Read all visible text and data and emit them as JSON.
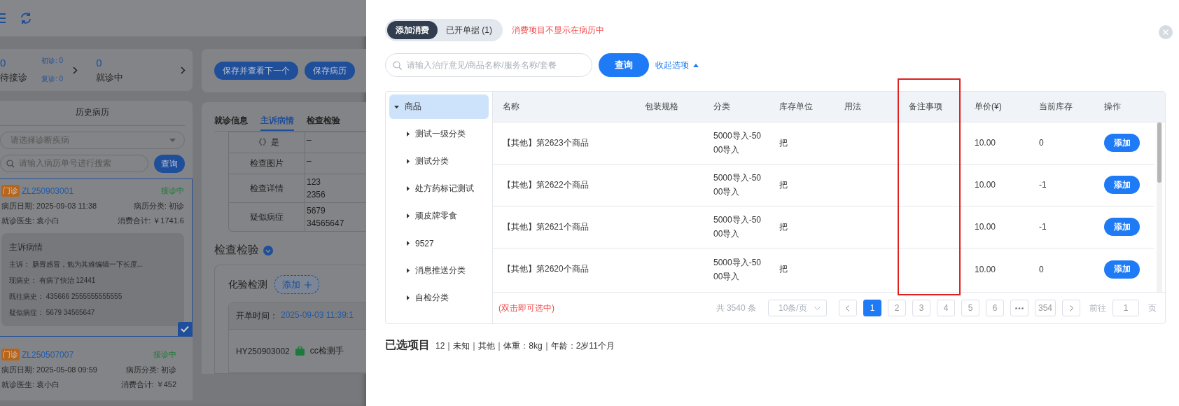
{
  "background_page": {
    "stats": {
      "waiting": {
        "count": "0",
        "label": "待接诊"
      },
      "first_visit": "初诊: 0",
      "revisit": "复诊: 0",
      "in_progress": {
        "count": "0",
        "label": "就诊中"
      }
    },
    "history": {
      "title": "历史病历",
      "diagnosis_select": {
        "placeholder": "请选择诊断疾病"
      },
      "search": {
        "placeholder": "请输入病历单号进行搜索"
      },
      "search_button": "查询",
      "records": [
        {
          "type_tag": "门诊",
          "record_no": "ZL250903001",
          "status": "接诊中",
          "date": "病历日期: 2025-09-03 11:38",
          "category": "病历分类: 初诊",
          "doctor": "就诊医生: 袁小白",
          "total": "消费合计: ￥1741.6",
          "selected": true,
          "summary": {
            "title": "主诉病情",
            "lines": [
              {
                "label": "主诉：",
                "value": "肠胃感冒，勉为其难编辑一下长度..."
              },
              {
                "label": "现病史：",
                "value": "有病了快治 12441"
              },
              {
                "label": "既往病史：",
                "value": "435666 2555555555555"
              },
              {
                "label": "疑似病症：",
                "value": "5679 34565647"
              }
            ]
          }
        },
        {
          "type_tag": "门诊",
          "record_no": "ZL250507007",
          "status": "接诊中",
          "date": "病历日期: 2025-05-08 09:59",
          "category": "病历分类: 初诊",
          "doctor": "就诊医生: 袁小白",
          "total": "消费合计: ￥452",
          "selected": false
        }
      ]
    },
    "action_buttons": [
      "保存并查看下一个",
      "保存病历"
    ],
    "tabs": [
      {
        "label": "就诊信息",
        "selected": false
      },
      {
        "label": "主诉病情",
        "selected": true
      },
      {
        "label": "检查检验",
        "selected": false
      }
    ],
    "exam_table": [
      {
        "label": "《》是",
        "lines": [
          "–"
        ]
      },
      {
        "label": "检查图片",
        "lines": [
          "–"
        ]
      },
      {
        "label": "检查详情",
        "lines": [
          "123",
          "2356"
        ]
      },
      {
        "label": "疑似病症",
        "lines": [
          "5679",
          "34565647"
        ]
      }
    ],
    "exam_section": {
      "title": "检查检验",
      "lab_title": "化验检测",
      "add_button": "添加",
      "order": {
        "time_label": "开单时间：",
        "time": "2025-09-03 11:39:1",
        "order_no": "HY250903002",
        "item": "cc检测手"
      }
    }
  },
  "drawer": {
    "tabs": [
      {
        "label": "添加消费",
        "selected": true
      },
      {
        "label": "已开单据 (1)",
        "selected": false
      }
    ],
    "notice": "消费项目不显示在病历中",
    "search": {
      "placeholder": "请输入治疗意见/商品名称/服务名称/套餐"
    },
    "search_button": "查询",
    "collapse_link": "收起选项",
    "categories": [
      {
        "label": "商品",
        "expanded": true,
        "selected": true,
        "children": [
          {
            "label": "测试一级分类",
            "expanded": false,
            "selected": false
          },
          {
            "label": "测试分类",
            "expanded": false,
            "selected": false
          },
          {
            "label": "处方药标记测试",
            "expanded": false,
            "selected": false
          },
          {
            "label": "顽皮牌零食",
            "expanded": false,
            "selected": false
          },
          {
            "label": "9527",
            "expanded": false,
            "selected": false
          },
          {
            "label": "消息推送分类",
            "expanded": false,
            "selected": false
          },
          {
            "label": "自检分类",
            "expanded": false,
            "selected": false
          }
        ]
      }
    ],
    "table": {
      "columns": [
        "名称",
        "包装规格",
        "分类",
        "库存单位",
        "用法",
        "备注事项",
        "单价(¥)",
        "当前库存",
        "操作"
      ],
      "rows": [
        {
          "name": "【其他】第2623个商品",
          "category": "5000导入-5000导入",
          "unit": "把",
          "price": "10.00",
          "stock": "0",
          "action": "添加"
        },
        {
          "name": "【其他】第2622个商品",
          "category": "5000导入-5000导入",
          "unit": "把",
          "price": "10.00",
          "stock": "-1",
          "action": "添加"
        },
        {
          "name": "【其他】第2621个商品",
          "category": "5000导入-5000导入",
          "unit": "把",
          "price": "10.00",
          "stock": "-1",
          "action": "添加"
        },
        {
          "name": "【其他】第2620个商品",
          "category": "5000导入-5000导入",
          "unit": "把",
          "price": "10.00",
          "stock": "0",
          "action": "添加"
        }
      ]
    },
    "pagination": {
      "hint": "(双击即可选中)",
      "total": "共 3540 条",
      "page_size": "10条/页",
      "pages": [
        {
          "kind": "page",
          "label": "1",
          "selected": true
        },
        {
          "kind": "page",
          "label": "2",
          "selected": false
        },
        {
          "kind": "page",
          "label": "3",
          "selected": false
        },
        {
          "kind": "page",
          "label": "4",
          "selected": false
        },
        {
          "kind": "page",
          "label": "5",
          "selected": false
        },
        {
          "kind": "page",
          "label": "6",
          "selected": false
        },
        {
          "kind": "ellipsis"
        },
        {
          "kind": "page",
          "label": "354",
          "selected": false
        }
      ],
      "goto_label": "前往",
      "goto_value": "1",
      "page_unit": "页"
    },
    "selected_items": {
      "title": "已选项目",
      "info": "12｜未知｜其他｜体重：8kg｜年龄：2岁11个月"
    }
  }
}
